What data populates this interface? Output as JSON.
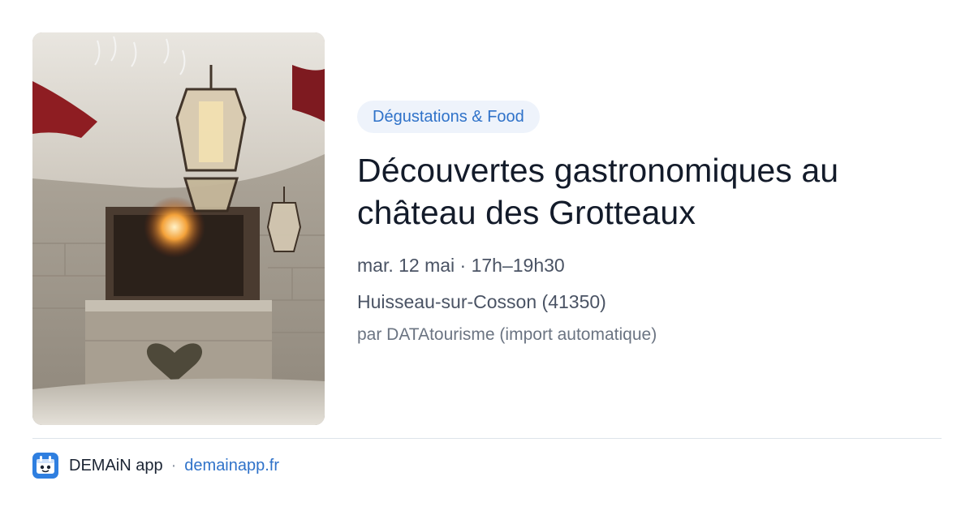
{
  "event": {
    "category": "Dégustations & Food",
    "title": "Découvertes gastronomiques au château des Grotteaux",
    "date_time": "mar. 12 mai · 17h–19h30",
    "location": "Huisseau-sur-Cosson (41350)",
    "source": "par DATAtourisme (import automatique)"
  },
  "footer": {
    "app_name": "DEMAiN app",
    "separator": "·",
    "domain": "demainapp.fr"
  },
  "colors": {
    "accent": "#2f72c9",
    "tag_background": "#eef3fb",
    "title": "#131b2a",
    "divider": "#dde3ea"
  },
  "icons": {
    "app_logo": "demain-app-icon"
  }
}
